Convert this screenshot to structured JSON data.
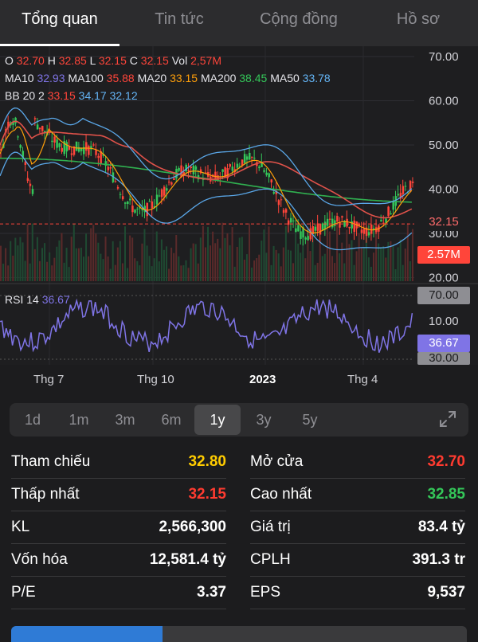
{
  "tabs": [
    {
      "label": "Tổng quan",
      "active": true
    },
    {
      "label": "Tin tức",
      "active": false
    },
    {
      "label": "Cộng đồng",
      "active": false
    },
    {
      "label": "Hồ sơ",
      "active": false
    }
  ],
  "legend": {
    "o_label": "O",
    "o": "32.70",
    "h_label": "H",
    "h": "32.85",
    "l_label": "L",
    "l": "32.15",
    "c_label": "C",
    "c": "32.15",
    "vol_label": "Vol",
    "vol": "2,57M",
    "ma10_label": "MA10",
    "ma10": "32.93",
    "ma100_label": "MA100",
    "ma100": "35.88",
    "ma20_label": "MA20",
    "ma20": "33.15",
    "ma200_label": "MA200",
    "ma200": "38.45",
    "ma50_label": "MA50",
    "ma50": "33.78",
    "bb_label": "BB 20 2",
    "bb1": "33.15",
    "bb2": "34.17",
    "bb3": "32.12",
    "rsi_label": "RSI 14",
    "rsi": "36.67"
  },
  "price_axis": [
    "70.00",
    "60.00",
    "50.00",
    "40.00",
    "30.00",
    "20.00"
  ],
  "price_tag": "32.15",
  "vol_tag": "2.57M",
  "rsi_axis": {
    "top": "70.00",
    "mid": "10.00",
    "bottom": "30.00"
  },
  "rsi_tag": "36.67",
  "x_labels": [
    "Thg 7",
    "Thg 10",
    "2023",
    "Thg 4"
  ],
  "ranges": [
    "1d",
    "1m",
    "3m",
    "6m",
    "1y",
    "3y",
    "5y"
  ],
  "active_range": "1y",
  "stats_left": [
    {
      "label": "Tham chiếu",
      "value": "32.80",
      "color": "#ffcc00"
    },
    {
      "label": "Thấp nhất",
      "value": "32.15",
      "color": "#ff3b30"
    },
    {
      "label": "KL",
      "value": "2,566,300",
      "color": "#ffffff"
    },
    {
      "label": "Vốn hóa",
      "value": "12,581.4 tỷ",
      "color": "#ffffff"
    },
    {
      "label": "P/E",
      "value": "3.37",
      "color": "#ffffff"
    }
  ],
  "stats_right": [
    {
      "label": "Mở cửa",
      "value": "32.70",
      "color": "#ff3b30"
    },
    {
      "label": "Cao nhất",
      "value": "32.85",
      "color": "#34c759"
    },
    {
      "label": "Giá trị",
      "value": "83.4 tỷ",
      "color": "#ffffff"
    },
    {
      "label": "CPLH",
      "value": "391.3 tr",
      "color": "#ffffff"
    },
    {
      "label": "EPS",
      "value": "9,537",
      "color": "#ffffff"
    }
  ],
  "colors": {
    "up": "#34c759",
    "down": "#ff453a",
    "rsi": "#7f74e6",
    "ma200": "#30b050",
    "ma100": "#e0524a",
    "bb": "#5aa7e8"
  }
}
